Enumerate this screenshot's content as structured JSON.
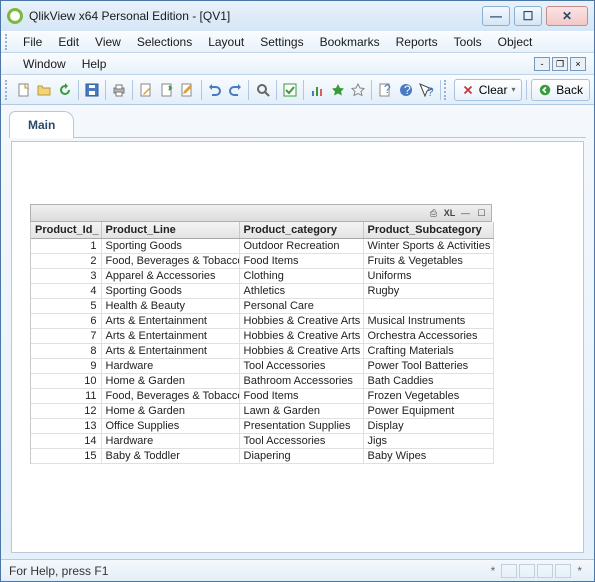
{
  "window": {
    "title": "QlikView x64 Personal Edition - [QV1]"
  },
  "menu": {
    "items": [
      "File",
      "Edit",
      "View",
      "Selections",
      "Layout",
      "Settings",
      "Bookmarks",
      "Reports",
      "Tools",
      "Object",
      "Window",
      "Help"
    ]
  },
  "toolbar": {
    "clear": "Clear",
    "back": "Back"
  },
  "tab": {
    "main": "Main"
  },
  "table": {
    "columns": [
      "Product_Id_",
      "Product_Line",
      "Product_category",
      "Product_Subcategory"
    ],
    "rows": [
      {
        "id": "1",
        "line": "Sporting Goods",
        "cat": "Outdoor Recreation",
        "sub": "Winter Sports & Activities"
      },
      {
        "id": "2",
        "line": "Food, Beverages & Tobacco",
        "cat": "Food Items",
        "sub": "Fruits & Vegetables"
      },
      {
        "id": "3",
        "line": "Apparel & Accessories",
        "cat": "Clothing",
        "sub": "Uniforms"
      },
      {
        "id": "4",
        "line": "Sporting Goods",
        "cat": "Athletics",
        "sub": "Rugby"
      },
      {
        "id": "5",
        "line": "Health & Beauty",
        "cat": "Personal Care",
        "sub": ""
      },
      {
        "id": "6",
        "line": "Arts & Entertainment",
        "cat": "Hobbies & Creative Arts",
        "sub": "Musical Instruments"
      },
      {
        "id": "7",
        "line": "Arts & Entertainment",
        "cat": "Hobbies & Creative Arts",
        "sub": "Orchestra Accessories"
      },
      {
        "id": "8",
        "line": "Arts & Entertainment",
        "cat": "Hobbies & Creative Arts",
        "sub": "Crafting Materials"
      },
      {
        "id": "9",
        "line": "Hardware",
        "cat": "Tool Accessories",
        "sub": "Power Tool Batteries"
      },
      {
        "id": "10",
        "line": "Home & Garden",
        "cat": "Bathroom Accessories",
        "sub": "Bath Caddies"
      },
      {
        "id": "11",
        "line": "Food, Beverages & Tobacco",
        "cat": "Food Items",
        "sub": "Frozen Vegetables"
      },
      {
        "id": "12",
        "line": "Home & Garden",
        "cat": "Lawn & Garden",
        "sub": "Power Equipment"
      },
      {
        "id": "13",
        "line": "Office Supplies",
        "cat": "Presentation Supplies",
        "sub": "Display"
      },
      {
        "id": "14",
        "line": "Hardware",
        "cat": "Tool Accessories",
        "sub": "Jigs"
      },
      {
        "id": "15",
        "line": "Baby & Toddler",
        "cat": "Diapering",
        "sub": "Baby Wipes"
      }
    ],
    "caption_xl": "XL"
  },
  "status": {
    "help": "For Help, press F1"
  }
}
